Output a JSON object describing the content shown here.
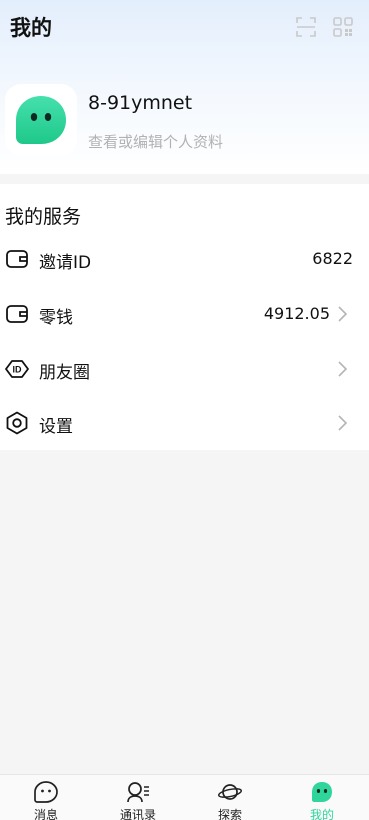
{
  "header": {
    "title": "我的"
  },
  "profile": {
    "username": "8-91ymnet",
    "edit_text": "查看或编辑个人资料"
  },
  "services": {
    "title": "我的服务",
    "items": [
      {
        "label": "邀请ID",
        "value": "6822",
        "icon": "wallet-icon"
      },
      {
        "label": "零钱",
        "value": "4912.05",
        "icon": "wallet-icon"
      },
      {
        "label": "朋友圈",
        "value": "",
        "icon": "id-tag-icon"
      },
      {
        "label": "设置",
        "value": "",
        "icon": "settings-hexagon-icon"
      }
    ]
  },
  "tabbar": {
    "tabs": [
      {
        "label": "消息",
        "icon": "chat-icon",
        "active": false
      },
      {
        "label": "通讯录",
        "icon": "contacts-icon",
        "active": false
      },
      {
        "label": "探索",
        "icon": "planet-icon",
        "active": false
      },
      {
        "label": "我的",
        "icon": "profile-ghost-icon",
        "active": true
      }
    ]
  },
  "colors": {
    "accent": "#2fd59a",
    "muted_text": "#b2b2b2",
    "header_gradient_top": "#e3eefc"
  }
}
